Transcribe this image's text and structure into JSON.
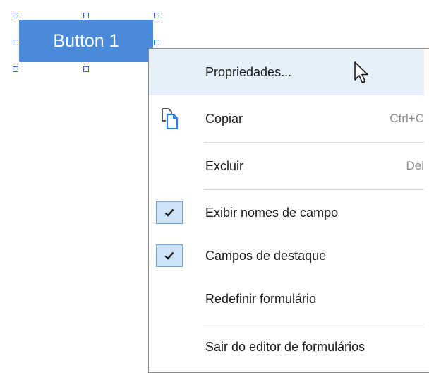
{
  "form_button": {
    "label": "Button 1",
    "color": "#4a8ad8"
  },
  "context_menu": {
    "highlight_color": "#e5f0fb",
    "items": [
      {
        "label": "Propriedades...",
        "shortcut": "",
        "icon": "",
        "checked": false,
        "highlighted": true
      },
      {
        "label": "Copiar",
        "shortcut": "Ctrl+C",
        "icon": "copy-icon",
        "checked": false,
        "highlighted": false
      },
      {
        "label": "Excluir",
        "shortcut": "Del",
        "icon": "",
        "checked": false,
        "highlighted": false
      },
      {
        "label": "Exibir nomes de campo",
        "shortcut": "",
        "icon": "check-icon",
        "checked": true,
        "highlighted": false
      },
      {
        "label": "Campos de destaque",
        "shortcut": "",
        "icon": "check-icon",
        "checked": true,
        "highlighted": false
      },
      {
        "label": "Redefinir formulário",
        "shortcut": "",
        "icon": "",
        "checked": false,
        "highlighted": false
      },
      {
        "label": "Sair do editor de formulários",
        "shortcut": "",
        "icon": "",
        "checked": false,
        "highlighted": false
      }
    ]
  },
  "cursor": {
    "icon": "mouse-pointer-icon"
  }
}
